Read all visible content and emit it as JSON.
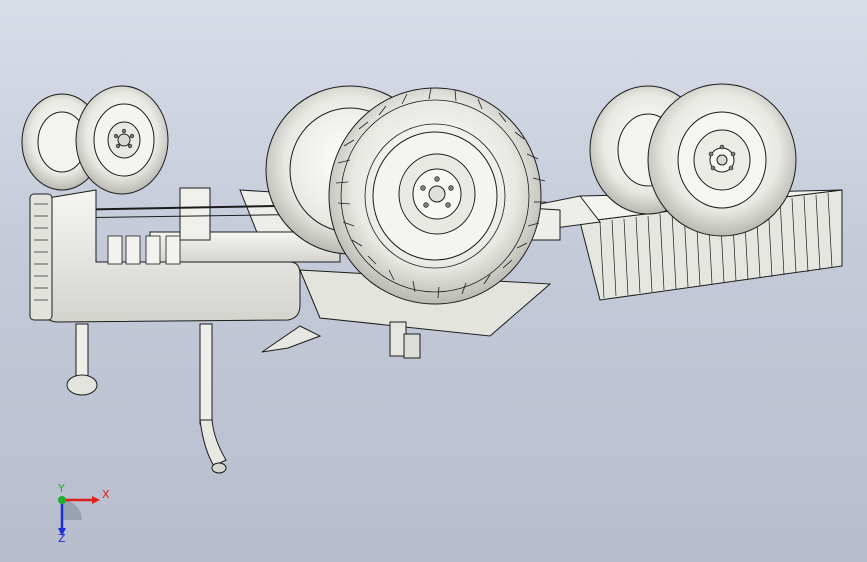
{
  "viewport": {
    "background_top": "#d8dde8",
    "background_bottom": "#b7bdcd",
    "model_fill": "#f2f2ef",
    "model_stroke": "#1c1c1c"
  },
  "triad": {
    "x_label": "X",
    "y_label": "Y",
    "z_label": "Z",
    "x_color": "#e0201c",
    "y_color": "#1fae2a",
    "z_color": "#1c2fd6"
  }
}
